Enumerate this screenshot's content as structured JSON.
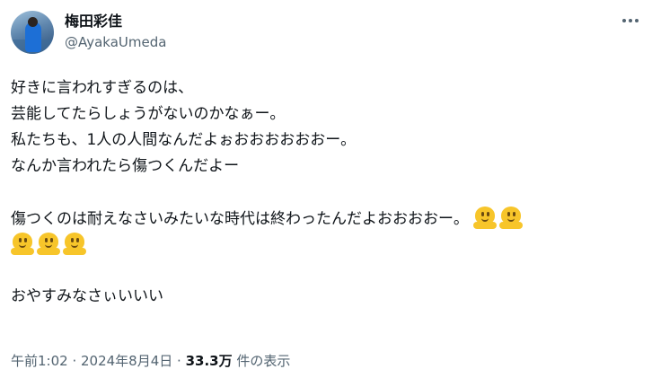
{
  "author": {
    "display_name": "梅田彩佳",
    "handle": "@AyakaUmeda"
  },
  "post": {
    "lines": [
      "好きに言われすぎるのは、",
      "芸能してたらしょうがないのかなぁー。",
      "私たちも、1人の人間なんだよぉおおおおおおー。",
      "なんか言われたら傷つくんだよー",
      "",
      "傷つくのは耐えなさいみたいな時代は終わったんだよおおおおー。",
      "",
      "",
      "おやすみなさぃいいい"
    ],
    "emoji_name": "melting-face-icon"
  },
  "meta": {
    "time": "午前1:02",
    "separator": " · ",
    "date": "2024年8月4日",
    "views_count": "33.3万",
    "views_label": " 件の表示"
  }
}
